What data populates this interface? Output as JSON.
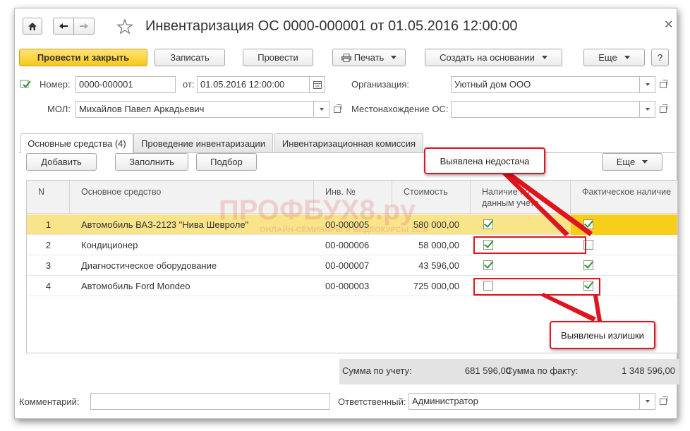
{
  "window": {
    "title": "Инвентаризация ОС 0000-000001 от 01.05.2016 12:00:00"
  },
  "toolbar": {
    "post_close": "Провести и закрыть",
    "save": "Записать",
    "post": "Провести",
    "print": "Печать",
    "create_based": "Создать на основании",
    "more": "Еще",
    "help": "?"
  },
  "header": {
    "number_label": "Номер:",
    "number_value": "0000-000001",
    "date_label": "от:",
    "date_value": "01.05.2016 12:00:00",
    "org_label": "Организация:",
    "org_value": "Уютный дом ООО",
    "mol_label": "МОЛ:",
    "mol_value": "Михайлов Павел Аркадьевич",
    "location_label": "Местонахождение ОС:",
    "location_value": ""
  },
  "tabs": [
    {
      "label": "Основные средства (4)"
    },
    {
      "label": "Проведение инвентаризации"
    },
    {
      "label": "Инвентаризационная комиссия"
    }
  ],
  "table_toolbar": {
    "add": "Добавить",
    "fill": "Заполнить",
    "pick": "Подбор",
    "more": "Еще"
  },
  "table": {
    "columns": [
      "N",
      "Основное средство",
      "Инв. №",
      "Стоимость",
      "Наличие по данным учета",
      "Фактическое наличие"
    ],
    "rows": [
      {
        "n": "1",
        "asset": "Автомобиль ВАЗ-2123 \"Нива Шевроле\"",
        "inv": "00-000005",
        "cost": "580 000,00",
        "accounted": true,
        "actual": true
      },
      {
        "n": "2",
        "asset": "Кондиционер",
        "inv": "00-000006",
        "cost": "58 000,00",
        "accounted": true,
        "actual": false
      },
      {
        "n": "3",
        "asset": "Диагностическое оборудование",
        "inv": "00-000007",
        "cost": "43 596,00",
        "accounted": true,
        "actual": true
      },
      {
        "n": "4",
        "asset": "Автомобиль Ford Mondeo",
        "inv": "00-000003",
        "cost": "725 000,00",
        "accounted": false,
        "actual": true
      }
    ]
  },
  "totals": {
    "by_account_label": "Сумма по учету:",
    "by_account_value": "681 596,00",
    "by_fact_label": "Сумма по факту:",
    "by_fact_value": "1 348 596,00"
  },
  "bottom": {
    "comment_label": "Комментарий:",
    "comment_value": "",
    "responsible_label": "Ответственный:",
    "responsible_value": "Администратор"
  },
  "annotations": {
    "shortage": "Выявлена недостача",
    "surplus": "Выявлены излишки",
    "color": "#e0141e"
  },
  "watermark": {
    "brand": "ПРОФБУХ8.ру",
    "tagline": "ОНЛАЙН-СЕМИНАРЫ И ВИДЕОКУРСЫ 1С:8"
  },
  "colors": {
    "primary_button": "#f7c917",
    "selected_row": "#f9e48a",
    "check": "#2e9a2e"
  }
}
